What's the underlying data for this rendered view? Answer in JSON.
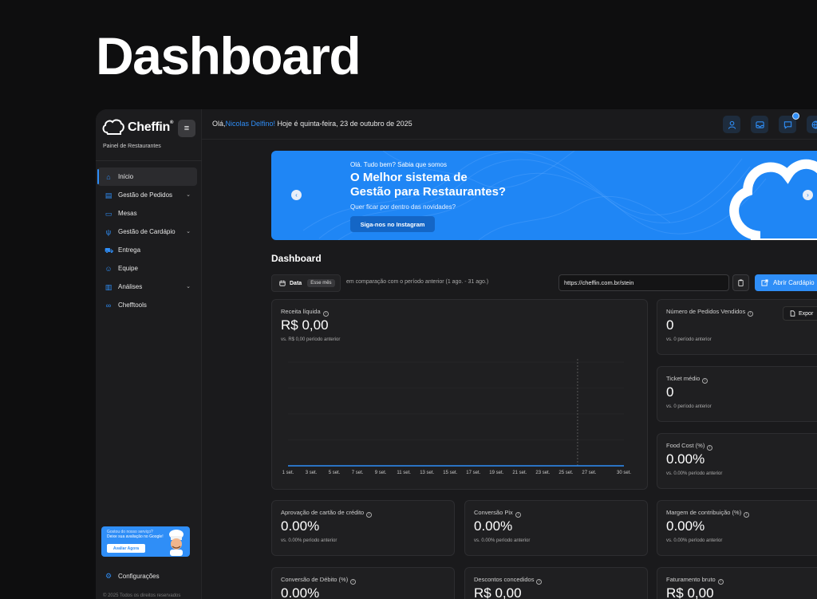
{
  "page": {
    "title": "Dashboard"
  },
  "brand": {
    "name": "Cheffin",
    "mark": "®",
    "subtitle": "Painel de Restaurantes"
  },
  "colors": {
    "accent": "#2f8ef7",
    "background": "#0e0e0f",
    "panel": "#1a1a1c"
  },
  "sidebar": {
    "items": [
      {
        "label": "Início",
        "icon": "home-icon",
        "active": true,
        "expandable": false
      },
      {
        "label": "Gestão de Pedidos",
        "icon": "orders-icon",
        "active": false,
        "expandable": true
      },
      {
        "label": "Mesas",
        "icon": "table-icon",
        "active": false,
        "expandable": false
      },
      {
        "label": "Gestão de Cardápio",
        "icon": "menu-icon",
        "active": false,
        "expandable": true
      },
      {
        "label": "Entrega",
        "icon": "truck-icon",
        "active": false,
        "expandable": false
      },
      {
        "label": "Equipe",
        "icon": "team-icon",
        "active": false,
        "expandable": false
      },
      {
        "label": "Análises",
        "icon": "chart-icon",
        "active": false,
        "expandable": true
      },
      {
        "label": "Chefftools",
        "icon": "link-icon",
        "active": false,
        "expandable": false
      }
    ],
    "promo": {
      "line1": "Gostou do nosso serviço?",
      "line2": "Deixe sua avaliação no Google!",
      "button": "Avaliar Agora"
    },
    "settings": "Configurações",
    "copyright": "© 2025 Todos os direitos reservados"
  },
  "topbar": {
    "greeting_prefix": "Olá,",
    "user_name": "Nicolas Delfino!",
    "greeting_suffix": " Hoje é quinta-feira, 23 de outubro de 2025",
    "icons": [
      "user-icon",
      "inbox-icon",
      "chat-icon",
      "globe-icon"
    ]
  },
  "banner": {
    "kicker": "Olá. Tudo bem? Sabia que somos",
    "headline_1": "O Melhor sistema de",
    "headline_2": "Gestão para Restaurantes?",
    "question": "Quer ficar por dentro das novidades?",
    "button": "Siga-nos no Instagram"
  },
  "dashboard": {
    "title": "Dashboard",
    "filter": {
      "label": "Data",
      "value": "Esse mês"
    },
    "comparison": "em comparação com o período anterior (1 ago. - 31 ago.)",
    "url": "https://cheffin.com.br/stein",
    "open_button": "Abrir Cardápio",
    "export_button": "Expor"
  },
  "cards": {
    "revenue": {
      "label": "Receita líquida",
      "value": "R$ 0,00",
      "sub": "vs. R$ 0,00 período anterior"
    },
    "orders": {
      "label": "Número de Pedidos Vendidos",
      "value": "0",
      "sub": "vs. 0 período anterior"
    },
    "ticket": {
      "label": "Ticket médio",
      "value": "0",
      "sub": "vs. 0 período anterior"
    },
    "food_cost": {
      "label": "Food Cost (%)",
      "value": "0.00%",
      "sub": "vs. 0.00% período anterior"
    },
    "credit": {
      "label": "Aprovação de cartão de crédito",
      "value": "0.00%",
      "sub": "vs. 0.00% período anterior"
    },
    "pix": {
      "label": "Conversão Pix",
      "value": "0.00%",
      "sub": "vs. 0.00% período anterior"
    },
    "margin": {
      "label": "Margem de contribuição (%)",
      "value": "0.00%",
      "sub": "vs. 0.00% período anterior"
    },
    "debit": {
      "label": "Conversão de Débito (%)",
      "value": "0.00%"
    },
    "discounts": {
      "label": "Descontos concedidos",
      "value": "R$ 0,00"
    },
    "gross": {
      "label": "Faturamento bruto",
      "value": "R$ 0,00"
    }
  },
  "chart_data": {
    "type": "line",
    "x": [
      "1 set.",
      "3 set.",
      "5 set.",
      "7 set.",
      "9 set.",
      "11 set.",
      "13 set.",
      "15 set.",
      "17 set.",
      "19 set.",
      "21 set.",
      "23 set.",
      "25 set.",
      "27 set.",
      "30 set."
    ],
    "series": [
      {
        "values": [
          0,
          0,
          0,
          0,
          0,
          0,
          0,
          0,
          0,
          0,
          0,
          0,
          0,
          0,
          0
        ]
      }
    ],
    "marker_x": "26 set.",
    "grid": true
  }
}
